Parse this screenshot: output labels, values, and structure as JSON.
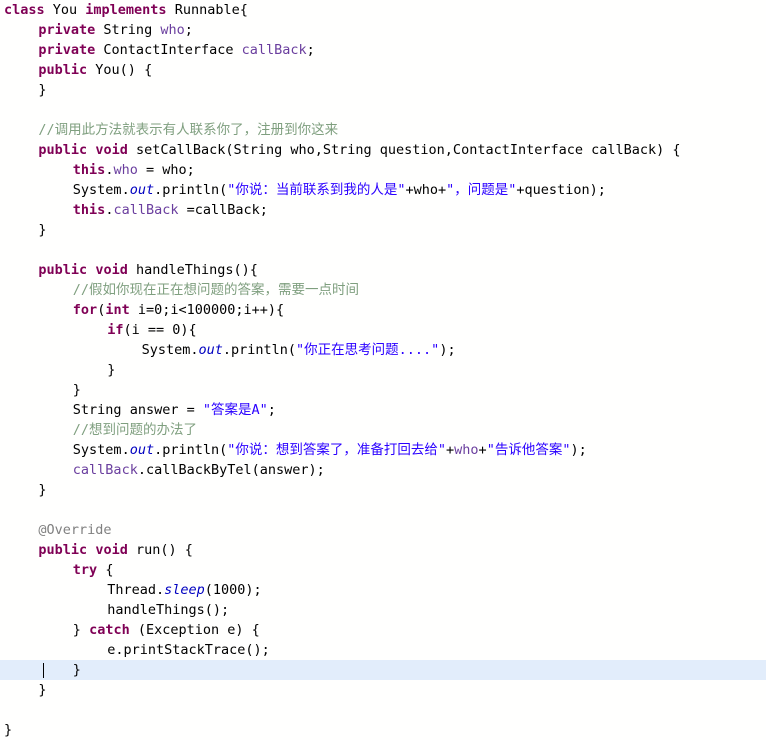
{
  "editor": {
    "language": "Java",
    "class_name": "You",
    "background_color": "#fffffe",
    "current_line_highlight_color": "#e2edfb",
    "keyword_color": "#7f0055",
    "string_color": "#2a00ff",
    "comment_color": "#7f9f7f",
    "field_color": "#6a3e9e",
    "annotation_color": "#808080",
    "caret": {
      "line_index": 32,
      "x": 39
    }
  },
  "lines": [
    {
      "indent": 0,
      "current": false,
      "tokens": [
        {
          "t": "class",
          "c": "kw"
        },
        {
          "t": " You ",
          "c": "plain"
        },
        {
          "t": "implements",
          "c": "kw"
        },
        {
          "t": " Runnable{",
          "c": "plain"
        }
      ]
    },
    {
      "indent": 1,
      "current": false,
      "tokens": [
        {
          "t": "private",
          "c": "kw"
        },
        {
          "t": " String ",
          "c": "plain"
        },
        {
          "t": "who",
          "c": "field"
        },
        {
          "t": ";",
          "c": "plain"
        }
      ]
    },
    {
      "indent": 1,
      "current": false,
      "tokens": [
        {
          "t": "private",
          "c": "kw"
        },
        {
          "t": " ContactInterface ",
          "c": "plain"
        },
        {
          "t": "callBack",
          "c": "field"
        },
        {
          "t": ";",
          "c": "plain"
        }
      ]
    },
    {
      "indent": 1,
      "current": false,
      "tokens": [
        {
          "t": "public",
          "c": "kw"
        },
        {
          "t": " You() {",
          "c": "plain"
        }
      ]
    },
    {
      "indent": 1,
      "current": false,
      "tokens": [
        {
          "t": "}",
          "c": "plain"
        }
      ]
    },
    {
      "indent": 0,
      "current": false,
      "tokens": []
    },
    {
      "indent": 1,
      "current": false,
      "tokens": [
        {
          "t": "//调用此方法就表示有人联系你了，注册到你这来",
          "c": "cmt"
        }
      ]
    },
    {
      "indent": 1,
      "current": false,
      "tokens": [
        {
          "t": "public",
          "c": "kw"
        },
        {
          "t": " ",
          "c": "plain"
        },
        {
          "t": "void",
          "c": "kw"
        },
        {
          "t": " setCallBack(String who,String question,ContactInterface callBack) {",
          "c": "plain"
        }
      ]
    },
    {
      "indent": 2,
      "current": false,
      "tokens": [
        {
          "t": "this",
          "c": "kw"
        },
        {
          "t": ".",
          "c": "plain"
        },
        {
          "t": "who",
          "c": "field"
        },
        {
          "t": " = who;",
          "c": "plain"
        }
      ]
    },
    {
      "indent": 2,
      "current": false,
      "tokens": [
        {
          "t": "System.",
          "c": "plain"
        },
        {
          "t": "out",
          "c": "stat"
        },
        {
          "t": ".println(",
          "c": "plain"
        },
        {
          "t": "\"你说：当前联系到我的人是\"",
          "c": "str"
        },
        {
          "t": "+who+",
          "c": "plain"
        },
        {
          "t": "\"，问题是\"",
          "c": "str"
        },
        {
          "t": "+question);",
          "c": "plain"
        }
      ]
    },
    {
      "indent": 2,
      "current": false,
      "tokens": [
        {
          "t": "this",
          "c": "kw"
        },
        {
          "t": ".",
          "c": "plain"
        },
        {
          "t": "callBack",
          "c": "field"
        },
        {
          "t": " =callBack;",
          "c": "plain"
        }
      ]
    },
    {
      "indent": 1,
      "current": false,
      "tokens": [
        {
          "t": "}",
          "c": "plain"
        }
      ]
    },
    {
      "indent": 0,
      "current": false,
      "tokens": []
    },
    {
      "indent": 1,
      "current": false,
      "tokens": [
        {
          "t": "public",
          "c": "kw"
        },
        {
          "t": " ",
          "c": "plain"
        },
        {
          "t": "void",
          "c": "kw"
        },
        {
          "t": " handleThings(){",
          "c": "plain"
        }
      ]
    },
    {
      "indent": 2,
      "current": false,
      "tokens": [
        {
          "t": "//假如你现在正在想问题的答案，需要一点时间",
          "c": "cmt"
        }
      ]
    },
    {
      "indent": 2,
      "current": false,
      "tokens": [
        {
          "t": "for",
          "c": "kw"
        },
        {
          "t": "(",
          "c": "plain"
        },
        {
          "t": "int",
          "c": "kw"
        },
        {
          "t": " i=0;i<100000;i++){",
          "c": "plain"
        }
      ]
    },
    {
      "indent": 3,
      "current": false,
      "tokens": [
        {
          "t": "if",
          "c": "kw"
        },
        {
          "t": "(i == 0){",
          "c": "plain"
        }
      ]
    },
    {
      "indent": 4,
      "current": false,
      "tokens": [
        {
          "t": "System.",
          "c": "plain"
        },
        {
          "t": "out",
          "c": "stat"
        },
        {
          "t": ".println(",
          "c": "plain"
        },
        {
          "t": "\"你正在思考问题....\"",
          "c": "str"
        },
        {
          "t": ");",
          "c": "plain"
        }
      ]
    },
    {
      "indent": 3,
      "current": false,
      "tokens": [
        {
          "t": "}",
          "c": "plain"
        }
      ]
    },
    {
      "indent": 2,
      "current": false,
      "tokens": [
        {
          "t": "}",
          "c": "plain"
        }
      ]
    },
    {
      "indent": 2,
      "current": false,
      "tokens": [
        {
          "t": "String answer = ",
          "c": "plain"
        },
        {
          "t": "\"答案是A\"",
          "c": "str"
        },
        {
          "t": ";",
          "c": "plain"
        }
      ]
    },
    {
      "indent": 2,
      "current": false,
      "tokens": [
        {
          "t": "//想到问题的办法了",
          "c": "cmt"
        }
      ]
    },
    {
      "indent": 2,
      "current": false,
      "tokens": [
        {
          "t": "System.",
          "c": "plain"
        },
        {
          "t": "out",
          "c": "stat"
        },
        {
          "t": ".println(",
          "c": "plain"
        },
        {
          "t": "\"你说：想到答案了，准备打回去给\"",
          "c": "str"
        },
        {
          "t": "+",
          "c": "plain"
        },
        {
          "t": "who",
          "c": "field"
        },
        {
          "t": "+",
          "c": "plain"
        },
        {
          "t": "\"告诉他答案\"",
          "c": "str"
        },
        {
          "t": ");",
          "c": "plain"
        }
      ]
    },
    {
      "indent": 2,
      "current": false,
      "tokens": [
        {
          "t": "callBack",
          "c": "field"
        },
        {
          "t": ".callBackByTel(answer);",
          "c": "plain"
        }
      ]
    },
    {
      "indent": 1,
      "current": false,
      "tokens": [
        {
          "t": "}",
          "c": "plain"
        }
      ]
    },
    {
      "indent": 0,
      "current": false,
      "tokens": []
    },
    {
      "indent": 1,
      "current": false,
      "tokens": [
        {
          "t": "@Override",
          "c": "ann"
        }
      ]
    },
    {
      "indent": 1,
      "current": false,
      "tokens": [
        {
          "t": "public",
          "c": "kw"
        },
        {
          "t": " ",
          "c": "plain"
        },
        {
          "t": "void",
          "c": "kw"
        },
        {
          "t": " run() {",
          "c": "plain"
        }
      ]
    },
    {
      "indent": 2,
      "current": false,
      "tokens": [
        {
          "t": "try",
          "c": "kw"
        },
        {
          "t": " {",
          "c": "plain"
        }
      ]
    },
    {
      "indent": 3,
      "current": false,
      "tokens": [
        {
          "t": "Thread.",
          "c": "plain"
        },
        {
          "t": "sleep",
          "c": "stat"
        },
        {
          "t": "(1000);",
          "c": "plain"
        }
      ]
    },
    {
      "indent": 3,
      "current": false,
      "tokens": [
        {
          "t": "handleThings();",
          "c": "plain"
        }
      ]
    },
    {
      "indent": 2,
      "current": false,
      "tokens": [
        {
          "t": "} ",
          "c": "plain"
        },
        {
          "t": "catch",
          "c": "kw"
        },
        {
          "t": " (Exception e) {",
          "c": "plain"
        }
      ]
    },
    {
      "indent": 3,
      "current": false,
      "tokens": [
        {
          "t": "e.printStackTrace();",
          "c": "plain"
        }
      ]
    },
    {
      "indent": 2,
      "current": true,
      "tokens": [
        {
          "t": "}",
          "c": "plain"
        }
      ]
    },
    {
      "indent": 1,
      "current": false,
      "tokens": [
        {
          "t": "}",
          "c": "plain"
        }
      ]
    },
    {
      "indent": 0,
      "current": false,
      "tokens": []
    },
    {
      "indent": 0,
      "current": false,
      "tokens": [
        {
          "t": "}",
          "c": "plain"
        }
      ]
    }
  ]
}
